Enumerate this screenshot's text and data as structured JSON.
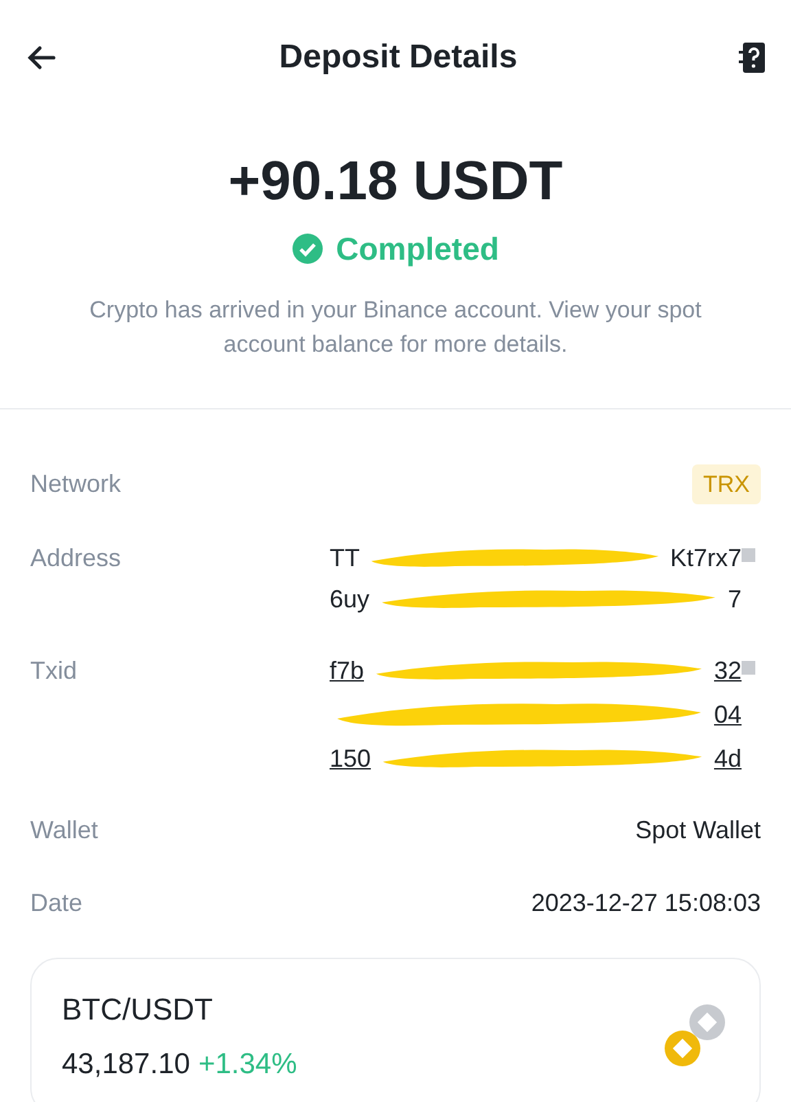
{
  "header": {
    "title": "Deposit Details"
  },
  "summary": {
    "amount": "+90.18 USDT",
    "status": "Completed",
    "message": "Crypto has arrived in your Binance account. View your spot account balance for more details."
  },
  "details": [
    {
      "kind": "badge",
      "label": "Network",
      "value": "TRX"
    },
    {
      "kind": "hash",
      "label": "Address",
      "link": false,
      "lines": [
        [
          "TT",
          "Kt7rx7"
        ],
        [
          "6uy",
          "7"
        ]
      ]
    },
    {
      "kind": "hash",
      "label": "Txid",
      "link": true,
      "lines": [
        [
          "f7b",
          "32"
        ],
        [
          "04"
        ],
        [
          "150",
          "4d"
        ]
      ]
    },
    {
      "kind": "text",
      "label": "Wallet",
      "value": "Spot Wallet"
    },
    {
      "kind": "text",
      "label": "Date",
      "value": "2023-12-27 15:08:03"
    }
  ],
  "market": {
    "pair": "BTC/USDT",
    "price": "43,187.10",
    "change": "+1.34%"
  }
}
